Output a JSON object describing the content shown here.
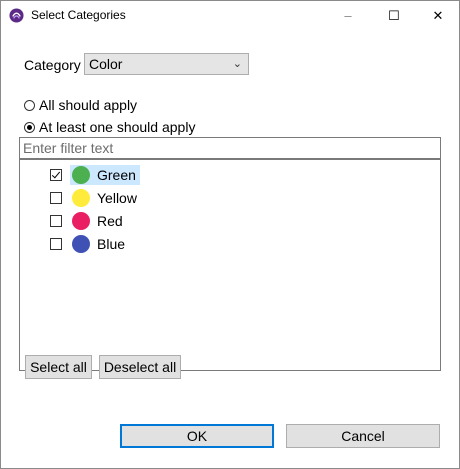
{
  "window": {
    "title": "Select Categories",
    "app_icon": "purple-logo-icon",
    "controls": {
      "minimize": "–",
      "maximize": "☐",
      "close": "✕"
    }
  },
  "category": {
    "label": "Category",
    "selected": "Color"
  },
  "match_mode": {
    "options": [
      {
        "label": "All should apply",
        "selected": false
      },
      {
        "label": "At least one should apply",
        "selected": true
      }
    ]
  },
  "filter": {
    "placeholder": "Enter filter text",
    "value": ""
  },
  "items": [
    {
      "label": "Green",
      "color": "#4caf50",
      "checked": true,
      "highlighted": true
    },
    {
      "label": "Yellow",
      "color": "#ffeb3b",
      "checked": false,
      "highlighted": false
    },
    {
      "label": "Red",
      "color": "#e91e63",
      "checked": false,
      "highlighted": false
    },
    {
      "label": "Blue",
      "color": "#3f51b5",
      "checked": false,
      "highlighted": false
    }
  ],
  "buttons": {
    "select_all": "Select all",
    "deselect_all": "Deselect all",
    "ok": "OK",
    "cancel": "Cancel"
  },
  "colors": {
    "accent": "#0078d7",
    "selection": "#cce8ff"
  }
}
